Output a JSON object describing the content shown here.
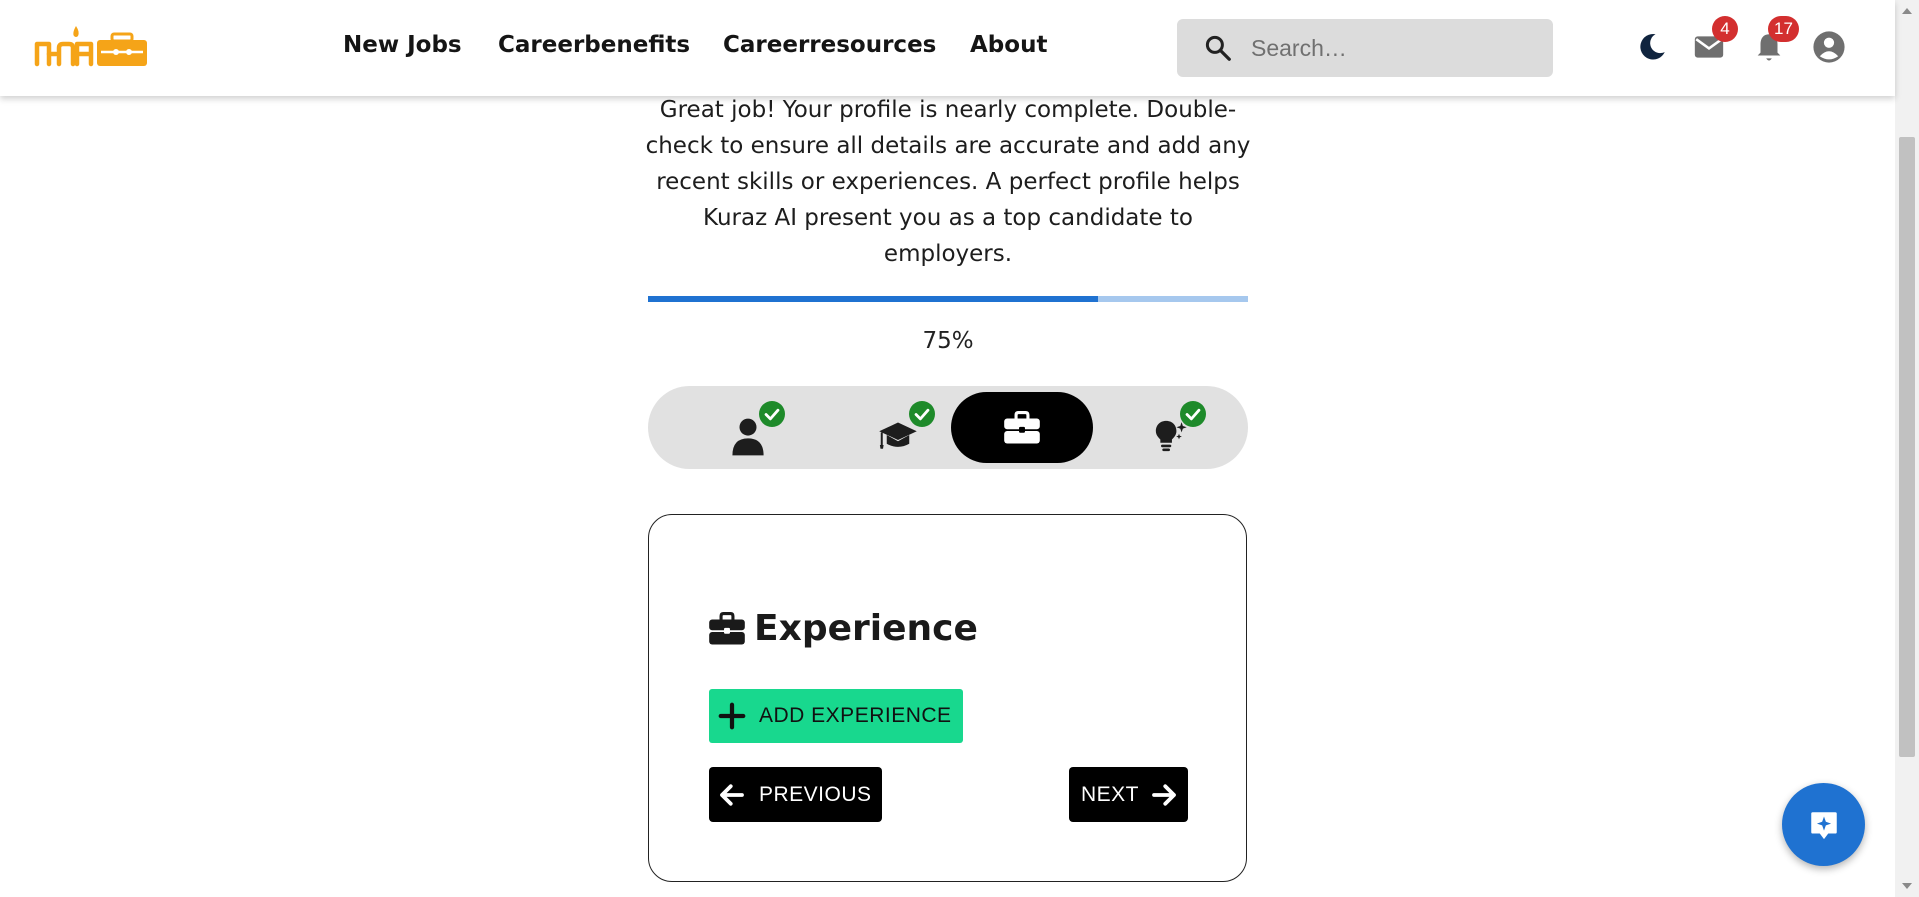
{
  "header": {
    "logo_alt": "Kuraz logo",
    "nav": [
      {
        "label": "New Jobs"
      },
      {
        "label": "Careerbenefits"
      },
      {
        "label": "Careerresources"
      },
      {
        "label": "About"
      }
    ],
    "search": {
      "placeholder": "Search…",
      "icon": "search-icon"
    },
    "icons": {
      "theme": "moon-icon",
      "mail": "mail-icon",
      "notifications": "bell-icon",
      "account": "account-circle-icon"
    },
    "mail_badge": "4",
    "notifications_badge": "17"
  },
  "profile": {
    "intro_text": "Great job! Your profile is nearly complete. Double-check to ensure all details are accurate and add any recent skills or experiences. A perfect profile helps Kuraz AI present you as a top candidate to employers.",
    "progress": 75,
    "progress_label": "75%",
    "steps": [
      {
        "icon": "person-icon",
        "completed": true
      },
      {
        "icon": "graduation-cap-icon",
        "completed": true
      },
      {
        "icon": "briefcase-icon",
        "completed": false,
        "active": true
      },
      {
        "icon": "lightbulb-icon",
        "completed": true
      }
    ]
  },
  "experience_card": {
    "title": "Experience",
    "title_icon": "briefcase-icon",
    "add_button": "ADD EXPERIENCE",
    "previous_button": "PREVIOUS",
    "next_button": "NEXT"
  },
  "fab": {
    "icon": "ai-assistant-icon"
  },
  "colors": {
    "brand_orange": "#f5a418",
    "progress_fill": "#1f72d1",
    "progress_track": "#a6c8ee",
    "add_button": "#18d88e",
    "check_green": "#1e8a2a",
    "badge_red": "#d32f2f"
  }
}
